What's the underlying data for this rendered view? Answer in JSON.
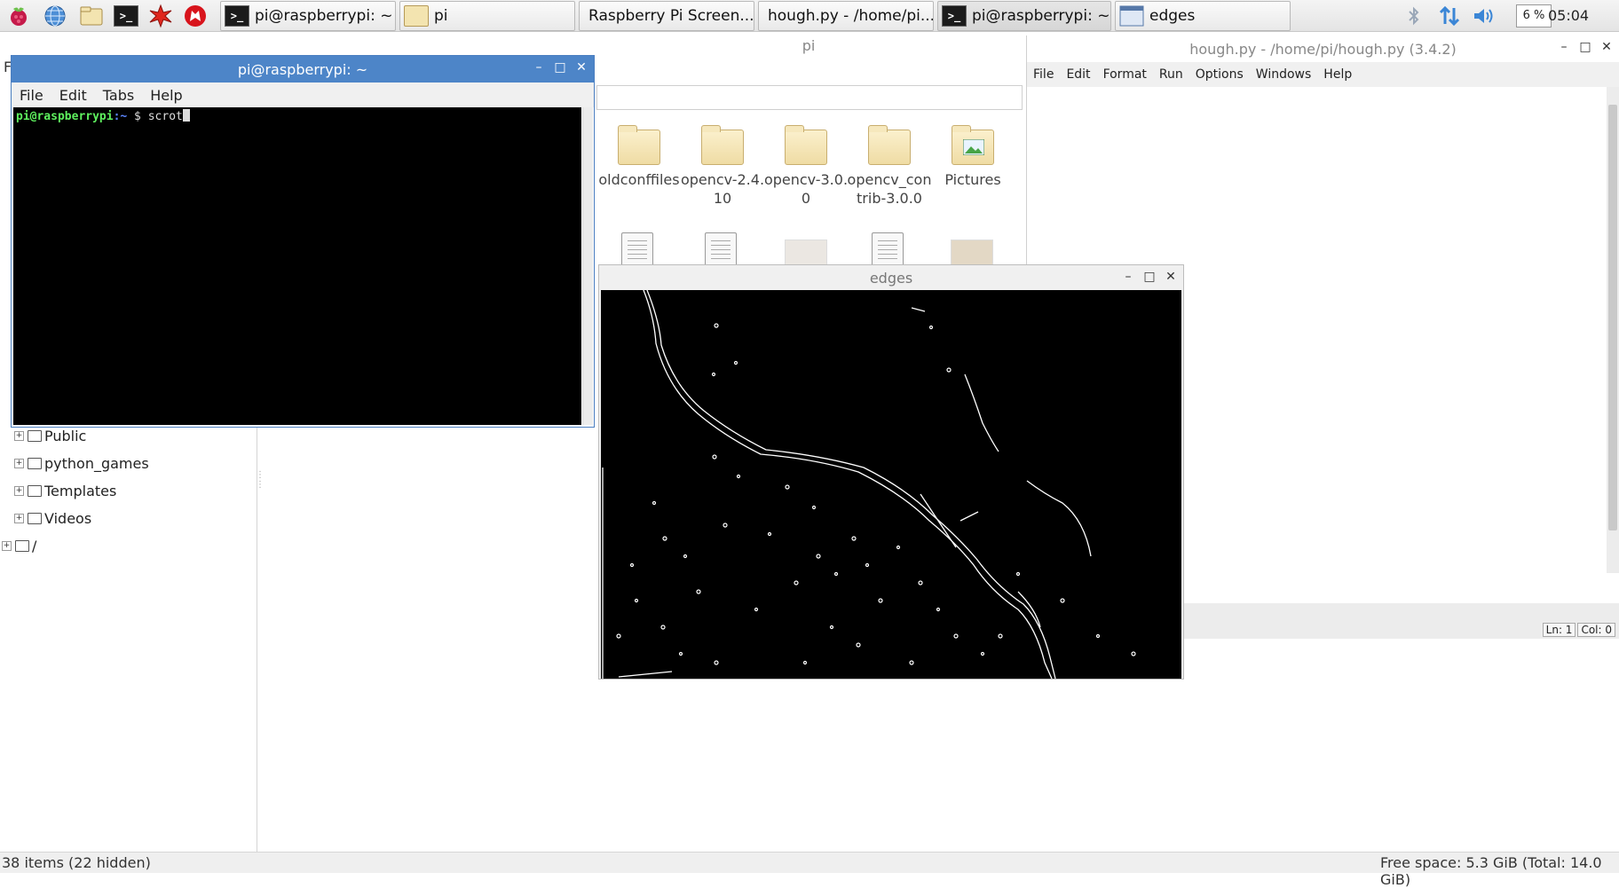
{
  "taskbar": {
    "launchers": [
      "raspberry-menu",
      "web-browser",
      "file-manager",
      "terminal",
      "mathematica",
      "wolfram"
    ],
    "tasks": [
      {
        "label": "pi@raspberrypi: ~",
        "icon": "terminal"
      },
      {
        "label": "pi",
        "icon": "folder"
      },
      {
        "label": "Raspberry Pi Screen...",
        "icon": "browser"
      },
      {
        "label": "hough.py - /home/pi...",
        "icon": "python"
      },
      {
        "label": "pi@raspberrypi: ~",
        "icon": "terminal"
      },
      {
        "label": "edges",
        "icon": "window"
      }
    ],
    "cpu": "6 %",
    "clock": "05:04"
  },
  "file_manager": {
    "title": "pi",
    "status_left": "38 items (22 hidden)",
    "status_right": "Free space: 5.3 GiB (Total: 14.0 GiB)",
    "tree": [
      "Public",
      "python_games",
      "Templates",
      "Videos",
      "/"
    ],
    "items": [
      {
        "name": "oldconffiles"
      },
      {
        "name": "opencv-2.4.10"
      },
      {
        "name": "opencv-3.0.0"
      },
      {
        "name": "opencv_contrib-3.0.0"
      },
      {
        "name": "Pictures"
      }
    ],
    "item_labels": {
      "i0": [
        "oldconffiles",
        ""
      ],
      "i1": [
        "opencv-2.4.",
        "10"
      ],
      "i2": [
        "opencv-3.0.",
        "0"
      ],
      "i3": [
        "opencv_con",
        "trib-3.0.0"
      ],
      "i4": [
        "Pictures",
        ""
      ]
    }
  },
  "terminal": {
    "title": "pi@raspberrypi: ~",
    "menu": [
      "File",
      "Edit",
      "Tabs",
      "Help"
    ],
    "prompt_user": "pi@raspberrypi",
    "prompt_path": ":~",
    "prompt_symbol": " $ ",
    "command": "scrot"
  },
  "idle": {
    "title": "hough.py - /home/pi/hough.py (3.4.2)",
    "menu": [
      "File",
      "Edit",
      "Format",
      "Run",
      "Options",
      "Windows",
      "Help"
    ],
    "status_line": "Ln: 1",
    "status_col": "Col: 0"
  },
  "edges_window": {
    "title": "edges"
  }
}
